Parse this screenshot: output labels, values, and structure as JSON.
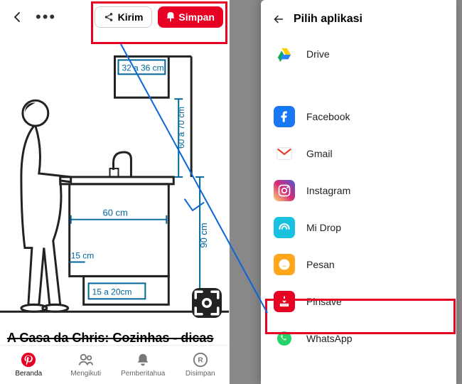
{
  "left": {
    "topbar": {
      "share_label": "Kirim",
      "save_label": "Simpan"
    },
    "diagram": {
      "top_box": "32 a 36 cm",
      "gap_h": "60 a 70 cm",
      "counter_w": "60 cm",
      "toe_kick": "15 cm",
      "toe_h": "15 a 20cm",
      "counter_h": "90 cm"
    },
    "title": "A Casa da Chris: Cozinhas - dicas",
    "nav": {
      "beranda": "Beranda",
      "mengikuti": "Mengikuti",
      "pemberitahua": "Pemberitahua",
      "disimpan": "Disimpan"
    }
  },
  "right": {
    "sheet_title": "Pilih aplikasi",
    "apps": [
      {
        "label": "Drive",
        "icon": "drive",
        "bg": "#fff"
      },
      {
        "label": "Facebook",
        "icon": "facebook",
        "bg": "#1877f2"
      },
      {
        "label": "Gmail",
        "icon": "gmail",
        "bg": "#fff"
      },
      {
        "label": "Instagram",
        "icon": "instagram",
        "bg": "linear-gradient(45deg,#feda75,#d62976,#4f5bd5)"
      },
      {
        "label": "Mi Drop",
        "icon": "midrop",
        "bg": "#18c1e0"
      },
      {
        "label": "Pesan",
        "icon": "pesan",
        "bg": "#ffa61a"
      },
      {
        "label": "Pinsave",
        "icon": "pinsave",
        "bg": "#e60023"
      },
      {
        "label": "WhatsApp",
        "icon": "whatsapp",
        "bg": "#fff"
      }
    ]
  }
}
